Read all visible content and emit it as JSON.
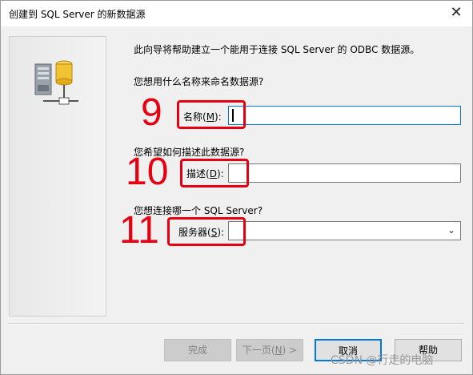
{
  "window": {
    "title": "创建到 SQL Server 的新数据源",
    "close_glyph": "✕"
  },
  "intro": "此向导将帮助建立一个能用于连接 SQL Server 的 ODBC 数据源。",
  "questions": {
    "name_q": "您想用什么名称来命名数据源?",
    "desc_q": "您希望如何描述此数据源?",
    "server_q": "您想连接哪一个 SQL Server?"
  },
  "fields": {
    "name_label": "名称(",
    "name_key": "M",
    "name_tail": "):",
    "name_value": "",
    "desc_label": "描述(",
    "desc_key": "D",
    "desc_tail": "):",
    "desc_value": "",
    "server_label": "服务器(",
    "server_key": "S",
    "server_tail": "):",
    "server_value": ""
  },
  "annotations": {
    "n9": "9",
    "n10": "10",
    "n11": "11",
    "color": "#e60012"
  },
  "buttons": {
    "finish": "完成",
    "next_pre": "下一页(",
    "next_key": "N",
    "next_tail": ") >",
    "cancel": "取消",
    "help": "帮助"
  },
  "watermark": "CSDN @行走的电脑",
  "icons": {
    "close": "close-icon",
    "dropdown": "chevron-down-icon",
    "illustration": "server-database-icon"
  }
}
